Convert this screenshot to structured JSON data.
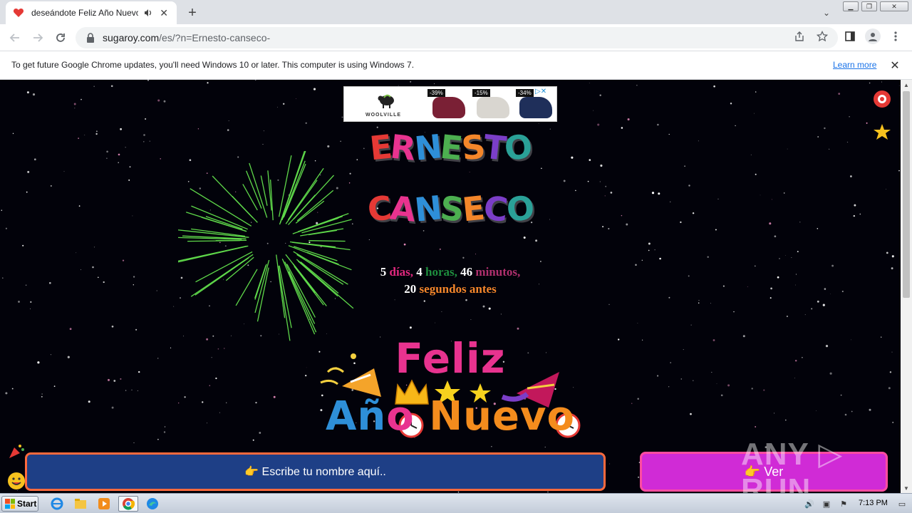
{
  "browser": {
    "tab": {
      "title": "deseándote Feliz Año Nuevo 20",
      "favicon": "heart-icon"
    },
    "url": {
      "domain": "sugaroy.com",
      "path": "/es/?n=Ernesto-canseco-"
    },
    "infobar": {
      "message": "To get future Google Chrome updates, you'll need Windows 10 or later. This computer is using Windows 7.",
      "link": "Learn more"
    }
  },
  "page": {
    "ad": {
      "brand": "WOOLVILLE",
      "discounts": [
        "-39%",
        "-15%",
        "-34%"
      ],
      "choice_icon": "adchoices-icon"
    },
    "name_first": "ERNESTO",
    "name_last": "CANSECO",
    "countdown": {
      "days": "5",
      "days_label": "días,",
      "hours": "4",
      "hours_label": "horas,",
      "minutes": "46",
      "minutes_label": "minutos,",
      "seconds": "20",
      "seconds_label": "segundos antes"
    },
    "greeting_line1": "Feliz",
    "greeting_line2": {
      "a": "Añ",
      "b": "o ",
      "c": "Nuevo"
    },
    "input_placeholder": "👉 Escribe tu nombre aquí..",
    "button_label": "👉 Ver",
    "watermark": "ANY ▷ RUN"
  },
  "taskbar": {
    "start_label": "Start",
    "clock": "7:13 PM"
  },
  "colors": {
    "background": "#02020a",
    "input_bg": "#1e3f86",
    "input_border": "#ff6a3d",
    "button_bg": "#d02bd6",
    "link": "#1a73e8"
  }
}
